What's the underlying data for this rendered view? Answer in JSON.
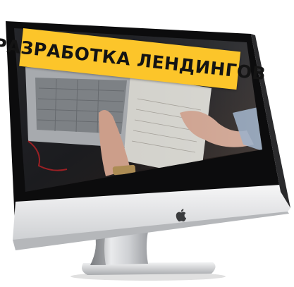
{
  "banner": {
    "title": "РАЗРАБОТКА ЛЕНДИНГОВ",
    "color": "#fcc52a"
  },
  "device": {
    "type": "desktop-monitor",
    "logo_icon": "apple-logo-icon"
  }
}
